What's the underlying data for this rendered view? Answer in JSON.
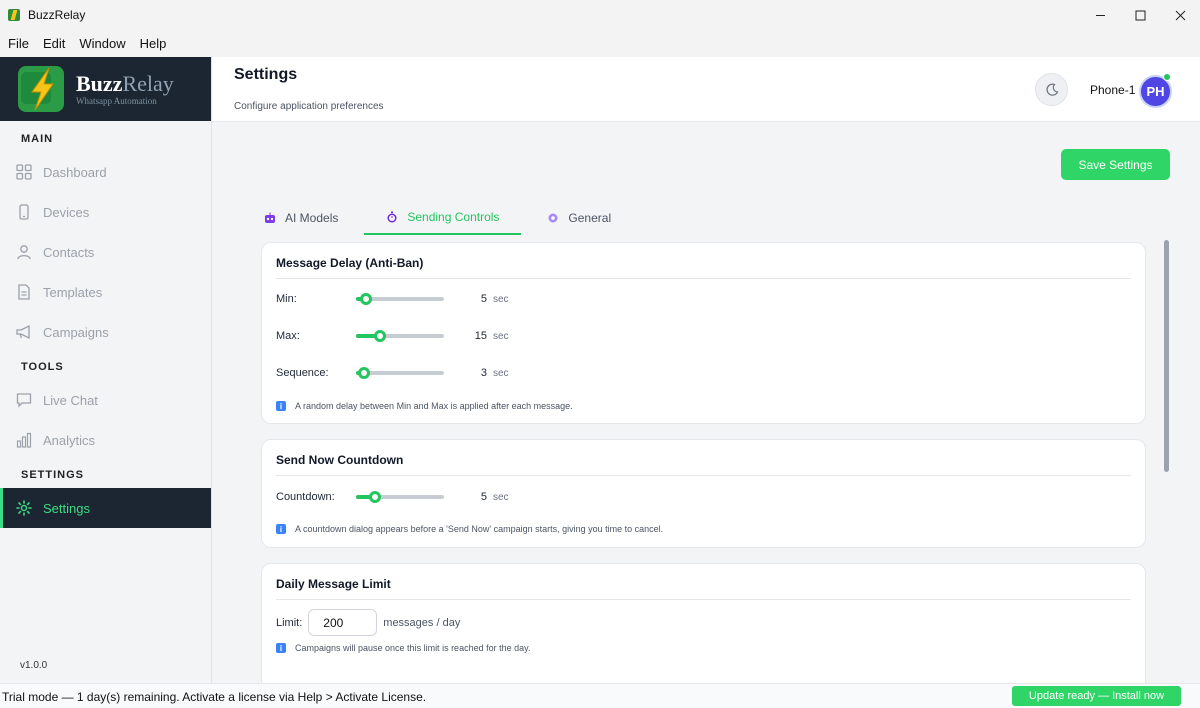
{
  "window": {
    "title": "BuzzRelay",
    "controls": [
      "minimize",
      "maximize",
      "close"
    ]
  },
  "menu": [
    "File",
    "Edit",
    "Window",
    "Help"
  ],
  "brand": {
    "name_part1": "Buzz",
    "name_part2": "Relay",
    "tagline": "Whatsapp Automation"
  },
  "sidebar": {
    "sections": {
      "main": "MAIN",
      "tools": "TOOLS",
      "settings": "SETTINGS"
    },
    "items": {
      "dashboard": {
        "label": "Dashboard",
        "icon": "grid-icon"
      },
      "devices": {
        "label": "Devices",
        "icon": "phone-icon"
      },
      "contacts": {
        "label": "Contacts",
        "icon": "user-icon"
      },
      "templates": {
        "label": "Templates",
        "icon": "document-icon"
      },
      "campaigns": {
        "label": "Campaigns",
        "icon": "megaphone-icon"
      },
      "live_chat": {
        "label": "Live Chat",
        "icon": "chat-icon"
      },
      "analytics": {
        "label": "Analytics",
        "icon": "bar-chart-icon"
      },
      "settings": {
        "label": "Settings",
        "icon": "gear-icon",
        "active": true
      }
    },
    "version": "v1.0.0"
  },
  "header": {
    "title": "Settings",
    "subtitle": "Configure application preferences",
    "device": "Phone-1",
    "avatar_initials": "PH",
    "online": true
  },
  "toolbar": {
    "save_label": "Save Settings"
  },
  "tabs": [
    {
      "label": "AI Models",
      "icon": "robot-icon",
      "active": false
    },
    {
      "label": "Sending Controls",
      "icon": "stopwatch-icon",
      "active": true
    },
    {
      "label": "General",
      "icon": "gear-icon",
      "active": false
    }
  ],
  "message_delay": {
    "title": "Message Delay  (Anti-Ban)",
    "rows": {
      "min": {
        "label": "Min:",
        "value": "5",
        "unit": "sec",
        "fraction": 0.05
      },
      "max": {
        "label": "Max:",
        "value": "15",
        "unit": "sec",
        "fraction": 0.24
      },
      "sequence": {
        "label": "Sequence:",
        "value": "3",
        "unit": "sec",
        "fraction": 0.03
      }
    },
    "info": "A random delay between Min and Max is applied after each message."
  },
  "countdown": {
    "title": "Send Now Countdown",
    "row": {
      "label": "Countdown:",
      "value": "5",
      "unit": "sec",
      "fraction": 0.17
    },
    "info": "A countdown dialog appears before a 'Send Now' campaign starts, giving you time to cancel."
  },
  "daily_limit": {
    "title": "Daily Message Limit",
    "label": "Limit:",
    "value": "200",
    "unit": "messages / day",
    "info": "Campaigns will pause once this limit is reached for the day."
  },
  "status": {
    "text": "Trial mode — 1 day(s) remaining. Activate a license via Help > Activate License.",
    "update_label": "Update ready — Install now"
  },
  "colors": {
    "accent": "#22c55e",
    "sidebar_dark": "#1b2632",
    "avatar": "#4f46e5",
    "info": "#3b82f6"
  }
}
